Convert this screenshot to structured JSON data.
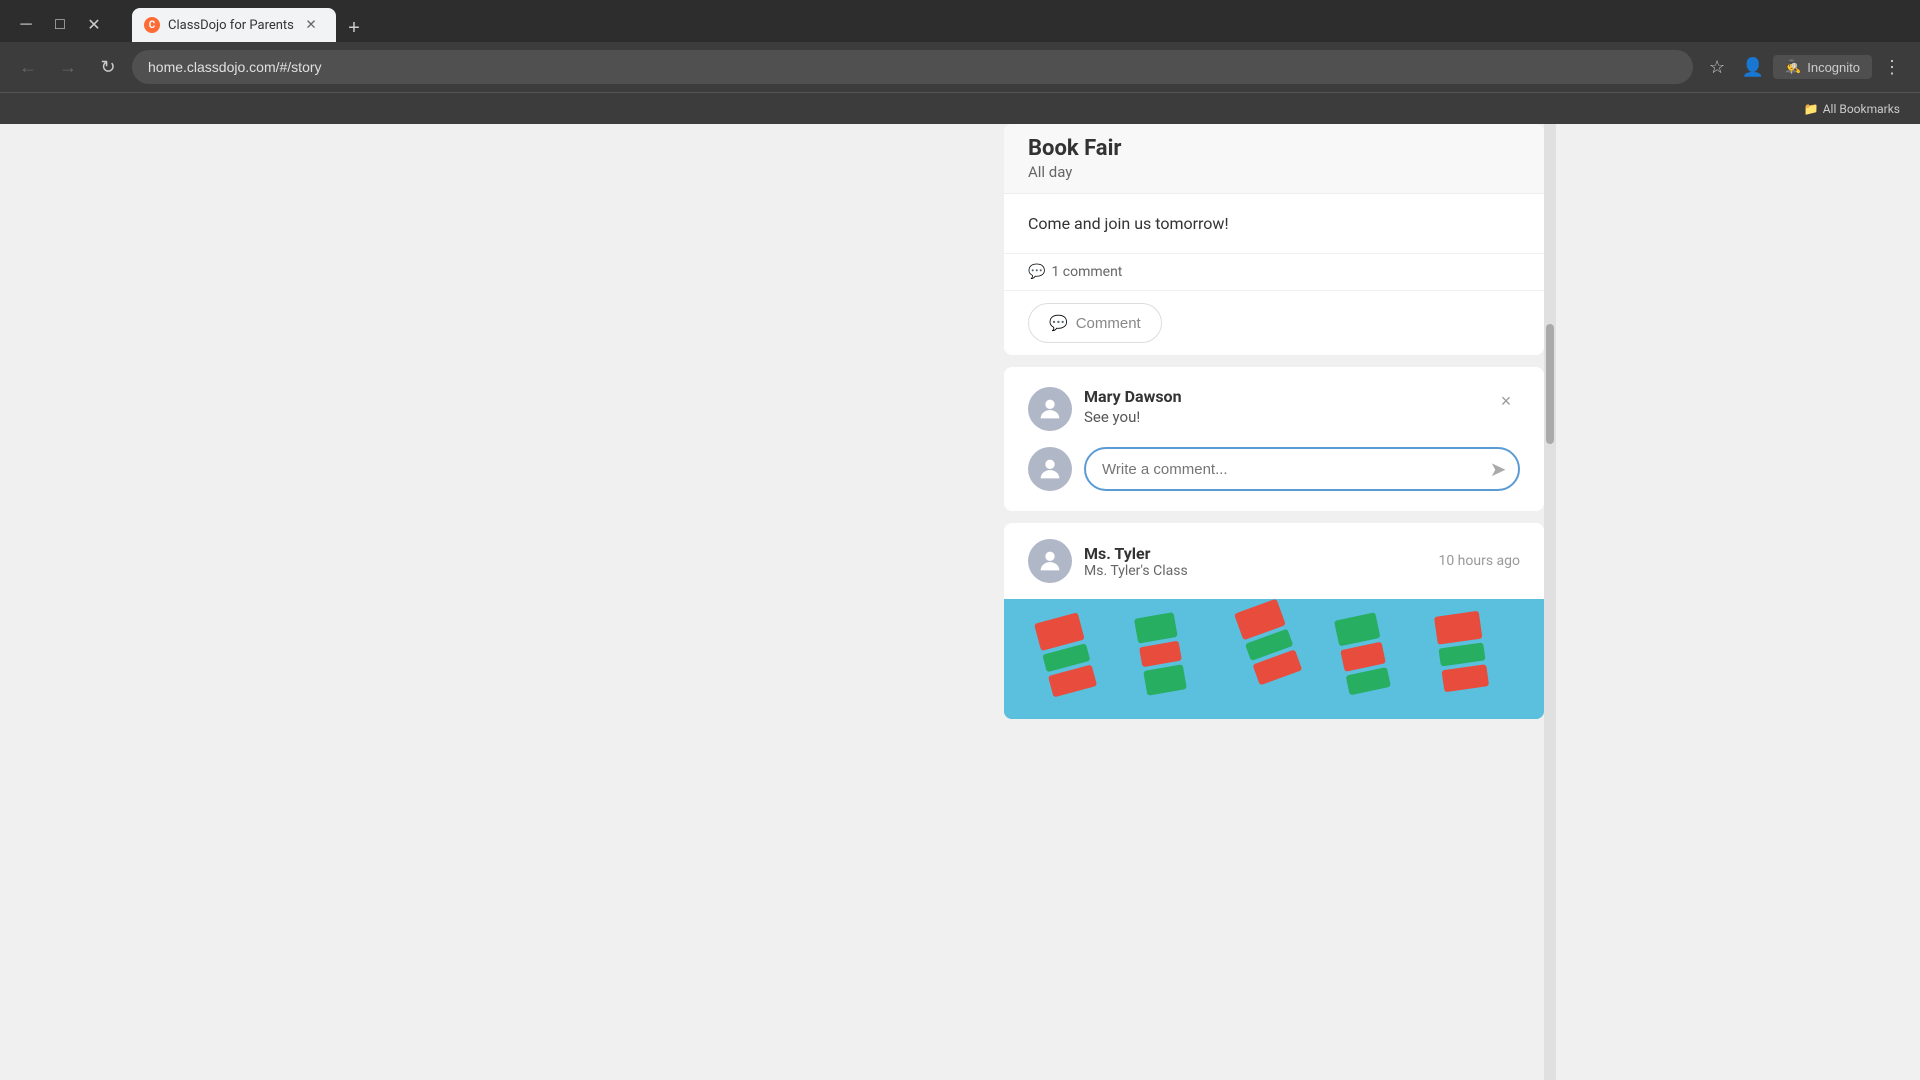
{
  "browser": {
    "tab": {
      "favicon_text": "C",
      "title": "ClassDojo for Parents",
      "url": "home.classdojo.com/#/story"
    },
    "nav": {
      "back_label": "←",
      "forward_label": "→",
      "refresh_label": "↻",
      "new_tab_label": "+"
    },
    "toolbar_right": {
      "star_label": "☆",
      "profile_label": "👤",
      "incognito_label": "Incognito",
      "menu_label": "⋮"
    },
    "bookmarks": {
      "all_bookmarks": "All Bookmarks"
    }
  },
  "page": {
    "event": {
      "title": "Book Fair",
      "subtitle": "All day",
      "description": "Come and join us tomorrow!",
      "comment_count_label": "1 comment"
    },
    "comment_button": {
      "label": "Comment",
      "icon": "💬"
    },
    "comment": {
      "author": "Mary Dawson",
      "text": "See you!",
      "delete_label": "×"
    },
    "comment_input": {
      "placeholder": "Write a comment...",
      "send_icon": "➤"
    },
    "post2": {
      "author": "Ms. Tyler",
      "class": "Ms. Tyler's Class",
      "time": "10 hours ago"
    }
  }
}
